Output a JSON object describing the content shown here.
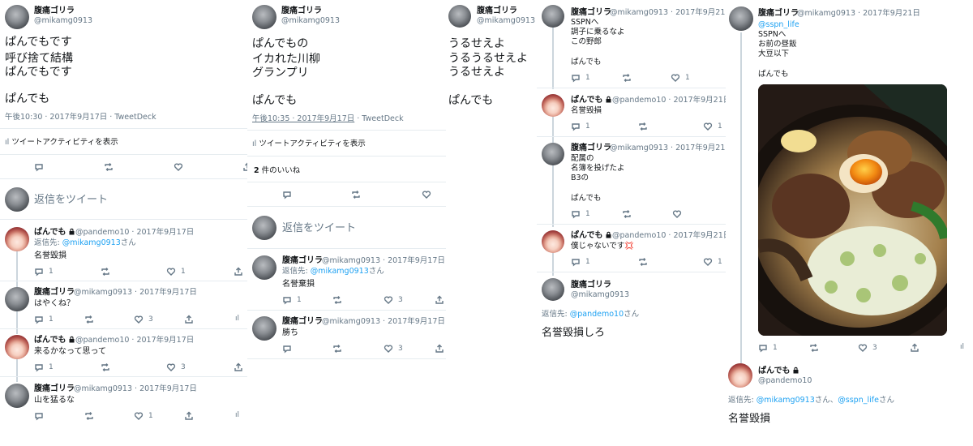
{
  "c1": {
    "main_name": "腹痛ゴリラ",
    "main_handle": "@mikamg0913",
    "main_lines": [
      "ぱんでもです",
      "呼び捨て結構",
      "ぱんでもです",
      "",
      "ぱんでも"
    ],
    "main_time": "午後10:30 · 2017年9月17日 · TweetDeck",
    "activity": "ツイートアクティビティを表示",
    "reply_placeholder": "返信をツイート",
    "replies": [
      {
        "name": "ぱんでも",
        "handle": "@pandemo10 · 2017年9月17日",
        "replyto_label": "返信先: ",
        "replyto": "@mikamg0913",
        "replyto_suffix": "さん",
        "text": "名誉毀損",
        "reply_count": "1",
        "like_count": "1"
      },
      {
        "name": "腹痛ゴリラ",
        "handle": "@mikamg0913 · 2017年9月17日",
        "text": "はやくね？",
        "reply_count": "1",
        "like_count": "3"
      },
      {
        "name": "ぱんでも",
        "handle": "@pandemo10 · 2017年9月17日",
        "text": "来るかなって思って",
        "reply_count": "1",
        "like_count": "3"
      },
      {
        "name": "腹痛ゴリラ",
        "handle": "@mikamg0913 · 2017年9月17日",
        "text": "山を猛るな",
        "reply_count": "",
        "like_count": "1"
      }
    ]
  },
  "c2": {
    "main_name": "腹痛ゴリラ",
    "main_handle": "@mikamg0913",
    "main_lines": [
      "ぱんでもの",
      "イカれた川柳",
      "グランプリ",
      "",
      "ぱんでも"
    ],
    "main_time": "午後10:35 · 2017年9月17日",
    "main_client": " · TweetDeck",
    "activity": "ツイートアクティビティを表示",
    "likes_count": "2",
    "likes_label": " 件のいいね",
    "reply_placeholder": "返信をツイート",
    "replies": [
      {
        "name": "腹痛ゴリラ",
        "handle": "@mikamg0913 · 2017年9月17日",
        "replyto_label": "返信先: ",
        "replyto": "@mikamg0913",
        "replyto_suffix": "さん",
        "text": "名誉棄損",
        "reply_count": "1",
        "like_count": "3"
      },
      {
        "name": "腹痛ゴリラ",
        "handle": "@mikamg0913 · 2017年9月17日",
        "text": "勝ち",
        "reply_count": "",
        "like_count": "3"
      }
    ]
  },
  "c3": {
    "main_name": "腹痛ゴリラ",
    "main_handle": "@mikamg0913",
    "main_lines": [
      "うるせえよ",
      "うるうるせえよ",
      "うるせえよ",
      "",
      "ぱんでも"
    ]
  },
  "c4": {
    "thread": [
      {
        "name": "腹痛ゴリラ",
        "handle": "@mikamg0913 · 2017年9月21日",
        "lines": [
          "SSPNへ",
          "調子に乗るなよ",
          "この野郎",
          "",
          "ぱんでも"
        ],
        "reply_count": "1",
        "like_count": "1"
      },
      {
        "name": "ぱんでも",
        "handle": "@pandemo10 · 2017年9月21日",
        "lines": [
          "名誉毀損"
        ],
        "reply_count": "1",
        "like_count": "1"
      },
      {
        "name": "腹痛ゴリラ",
        "handle": "@mikamg0913 · 2017年9月21日",
        "lines": [
          "配属の",
          "名簿を投げたよ",
          "B3の",
          "",
          "ぱんでも"
        ],
        "reply_count": "1",
        "like_count": ""
      },
      {
        "name": "ぱんでも",
        "handle": "@pandemo10 · 2017年9月21日",
        "lines": [
          "僕じゃないです💢"
        ],
        "reply_count": "1",
        "like_count": "1"
      }
    ],
    "main_name": "腹痛ゴリラ",
    "main_handle": "@mikamg0913",
    "replyto_label": "返信先: ",
    "replyto": "@pandemo10",
    "replyto_suffix": "さん",
    "main_text": "名誉毀損しろ"
  },
  "c5": {
    "top_name": "腹痛ゴリラ",
    "top_handle": "@mikamg0913 · 2017年9月21日",
    "top_mention": "@sspn_life",
    "top_lines": [
      "SSPNへ",
      "お前の昼飯",
      "大豆以下",
      "",
      "ぱんでも"
    ],
    "top_reply_count": "1",
    "top_like_count": "3",
    "image_icon": "ramen-photo",
    "main_name": "ぱんでも",
    "main_handle": "@pandemo10",
    "replyto_label": "返信先: ",
    "replyto_a": "@mikamg0913",
    "replyto_mid": "さん、",
    "replyto_b": "@sspn_life",
    "replyto_suffix": "さん",
    "main_text": "名誉毀損"
  },
  "colors": {
    "link": "#1da1f2",
    "muted": "#657786",
    "border": "#e6ecf0"
  }
}
